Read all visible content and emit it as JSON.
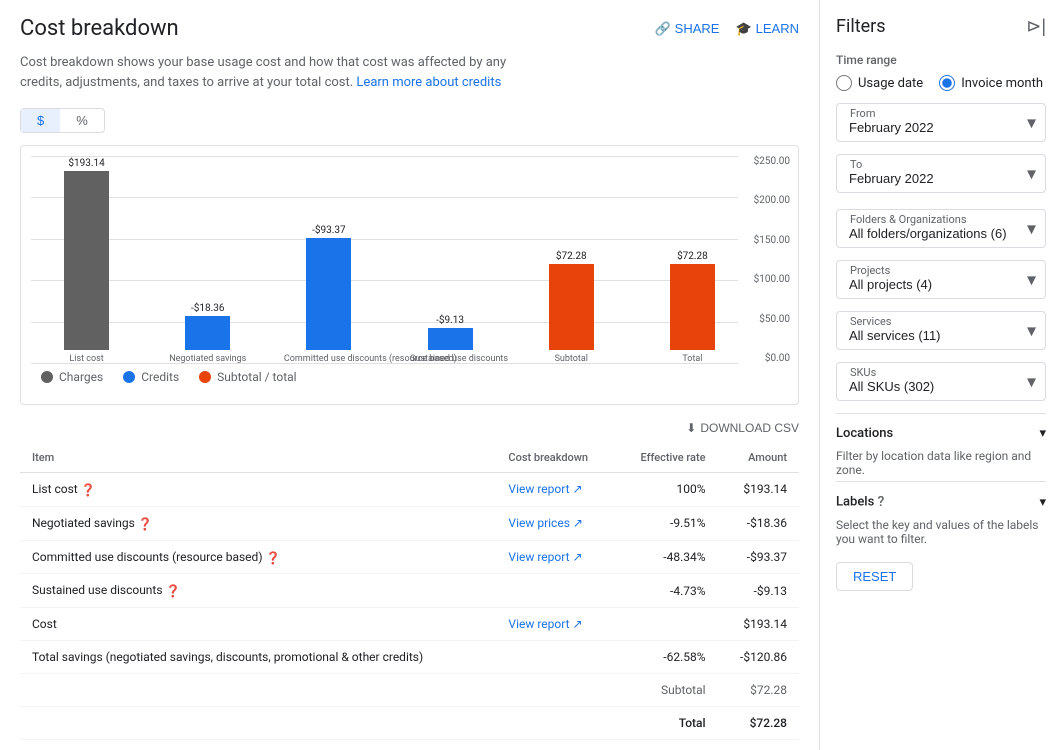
{
  "page": {
    "title": "Cost breakdown",
    "share_label": "SHARE",
    "learn_label": "LEARN",
    "description": "Cost breakdown shows your base usage cost and how that cost was affected by any credits, adjustments, and taxes to arrive at your total cost.",
    "learn_link": "Learn more about credits"
  },
  "toggle": {
    "dollar_label": "$",
    "percent_label": "%"
  },
  "chart": {
    "y_axis": [
      "$250.00",
      "$200.00",
      "$150.00",
      "$100.00",
      "$50.00",
      "$0.00"
    ],
    "bars": [
      {
        "label": "$193.14",
        "type": "charge",
        "height_pct": 77.3,
        "bottom_label": "List cost",
        "color": "#616161"
      },
      {
        "label": "-$18.36",
        "type": "credit",
        "height_pct": 7.3,
        "bottom_label": "Negotiated savings",
        "color": "#1a73e8"
      },
      {
        "label": "-$93.37",
        "type": "credit",
        "height_pct": 37.3,
        "bottom_label": "Committed use discounts\n(resource based)",
        "color": "#1a73e8"
      },
      {
        "label": "-$9.13",
        "type": "credit",
        "height_pct": 3.7,
        "bottom_label": "Sustained use discounts",
        "color": "#1a73e8"
      },
      {
        "label": "$72.28",
        "type": "subtotal",
        "height_pct": 28.9,
        "bottom_label": "Subtotal",
        "color": "#e8430a"
      },
      {
        "label": "$72.28",
        "type": "subtotal",
        "height_pct": 28.9,
        "bottom_label": "Total",
        "color": "#e8430a"
      }
    ],
    "legend": [
      {
        "label": "Charges",
        "color": "#616161"
      },
      {
        "label": "Credits",
        "color": "#1a73e8"
      },
      {
        "label": "Subtotal / total",
        "color": "#e8430a"
      }
    ]
  },
  "table": {
    "download_label": "DOWNLOAD CSV",
    "headers": [
      "Item",
      "Cost breakdown",
      "Effective rate",
      "Amount"
    ],
    "rows": [
      {
        "item": "List cost",
        "has_help": true,
        "cost_breakdown": "View report",
        "cost_link": true,
        "effective_rate": "100%",
        "amount": "$193.14"
      },
      {
        "item": "Negotiated savings",
        "has_help": true,
        "cost_breakdown": "View prices",
        "cost_link": true,
        "effective_rate": "-9.51%",
        "amount": "-$18.36"
      },
      {
        "item": "Committed use discounts (resource based)",
        "has_help": true,
        "cost_breakdown": "View report",
        "cost_link": true,
        "effective_rate": "-48.34%",
        "amount": "-$93.37"
      },
      {
        "item": "Sustained use discounts",
        "has_help": true,
        "cost_breakdown": "",
        "cost_link": false,
        "effective_rate": "-4.73%",
        "amount": "-$9.13"
      },
      {
        "item": "Cost",
        "has_help": false,
        "cost_breakdown": "View report",
        "cost_link": true,
        "effective_rate": "",
        "amount": "$193.14"
      },
      {
        "item": "Total savings (negotiated savings, discounts, promotional & other credits)",
        "has_help": false,
        "cost_breakdown": "",
        "cost_link": false,
        "effective_rate": "-62.58%",
        "amount": "-$120.86"
      }
    ],
    "subtotal_label": "Subtotal",
    "subtotal_amount": "$72.28",
    "total_label": "Total",
    "total_amount": "$72.28"
  },
  "filters": {
    "title": "Filters",
    "time_range_label": "Time range",
    "usage_date_label": "Usage date",
    "invoice_month_label": "Invoice month",
    "from_label": "From",
    "from_value": "February 2022",
    "to_label": "To",
    "to_value": "February 2022",
    "folders_label": "Folders & Organizations",
    "folders_value": "All folders/organizations (6)",
    "projects_label": "Projects",
    "projects_value": "All projects (4)",
    "services_label": "Services",
    "services_value": "All services (11)",
    "skus_label": "SKUs",
    "skus_value": "All SKUs (302)",
    "locations_label": "Locations",
    "locations_desc": "Filter by location data like region and zone.",
    "labels_label": "Labels",
    "labels_desc": "Select the key and values of the labels you want to filter.",
    "reset_label": "RESET"
  }
}
